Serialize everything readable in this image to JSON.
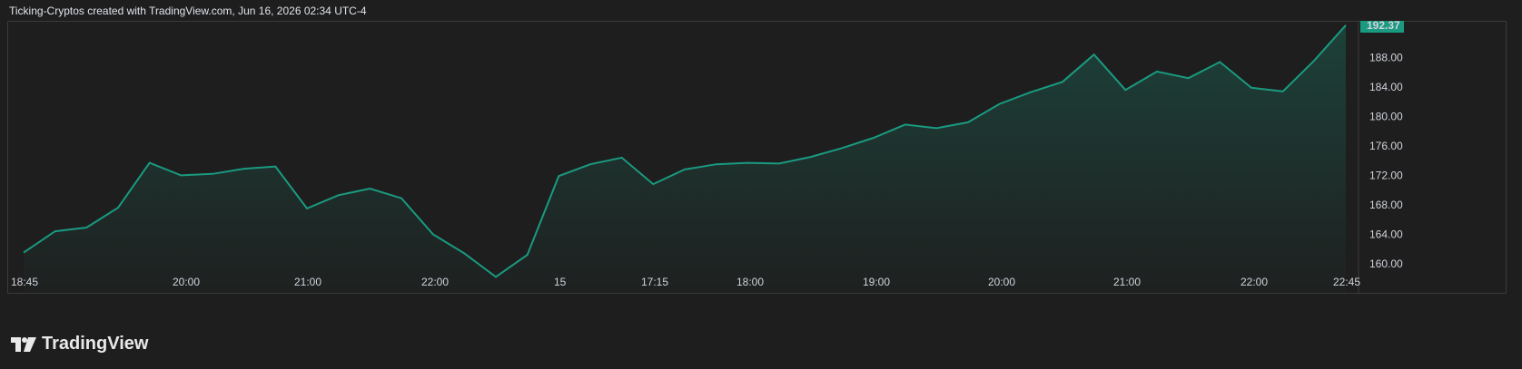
{
  "header": {
    "caption": "Ticking-Cryptos created with TradingView.com, Jun 16, 2026 02:34 UTC-4"
  },
  "brand": {
    "name": "TradingView"
  },
  "colors": {
    "line": "#1a9a80",
    "last_price_badge": "#1a9a80",
    "background": "#1e1e1e"
  },
  "chart_data": {
    "type": "area",
    "x_tick_labels": [
      "18:45",
      "20:00",
      "21:00",
      "22:00",
      "15",
      "17:15",
      "18:00",
      "19:00",
      "20:00",
      "21:00",
      "22:00",
      "22:45"
    ],
    "y_tick_labels": [
      "188.00",
      "184.00",
      "180.00",
      "176.00",
      "172.00",
      "168.00",
      "164.00",
      "160.00"
    ],
    "ylim": [
      158.5,
      192.37
    ],
    "last_price": "192.37",
    "series": [
      {
        "values": [
          161.5,
          164.4,
          164.9,
          167.6,
          173.7,
          172.0,
          172.2,
          172.9,
          173.2,
          167.5,
          169.3,
          170.2,
          168.9,
          164.0,
          161.4,
          158.2,
          161.2,
          171.9,
          173.5,
          174.4,
          170.8,
          172.8,
          173.5,
          173.7,
          173.6,
          174.5,
          175.7,
          177.1,
          178.9,
          178.4,
          179.2,
          181.7,
          183.3,
          184.7,
          188.4,
          183.6,
          186.1,
          185.2,
          187.4,
          183.9,
          183.4,
          187.6,
          192.4
        ]
      }
    ],
    "grid": false
  }
}
